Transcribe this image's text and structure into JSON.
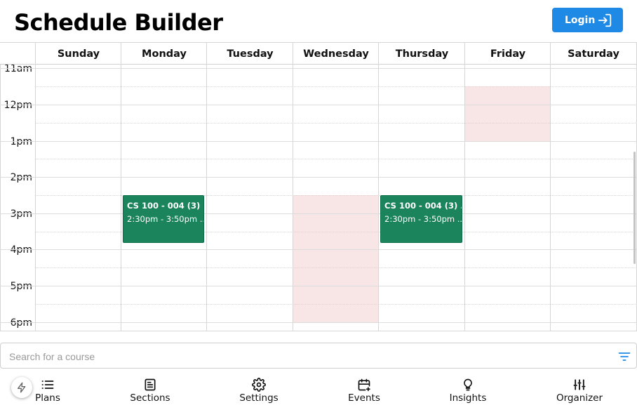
{
  "app": {
    "title": "Schedule Builder"
  },
  "header": {
    "login_label": "Login"
  },
  "colors": {
    "accent": "#1f8ae6",
    "event": "#1b845c",
    "unavailable": "#f8e6e7"
  },
  "calendar": {
    "days": [
      "Sunday",
      "Monday",
      "Tuesday",
      "Wednesday",
      "Thursday",
      "Friday",
      "Saturday"
    ],
    "hours": [
      "11am",
      "12pm",
      "1pm",
      "2pm",
      "3pm",
      "4pm",
      "5pm",
      "6pm"
    ],
    "events": [
      {
        "title": "CS 100 - 004 (3) ...",
        "time": "2:30pm - 3:50pm ...",
        "day": "Monday"
      },
      {
        "title": "CS 100 - 004 (3) ...",
        "time": "2:30pm - 3:50pm ...",
        "day": "Thursday"
      }
    ],
    "unavailable": [
      {
        "day": "Friday",
        "start": "12pm",
        "end": "1pm"
      },
      {
        "day": "Wednesday",
        "start": "2:30pm",
        "end": "6:30pm"
      }
    ]
  },
  "search": {
    "placeholder": "Search for a course",
    "value": ""
  },
  "nav": [
    {
      "label": "Plans",
      "icon": "list-icon"
    },
    {
      "label": "Sections",
      "icon": "document-icon"
    },
    {
      "label": "Settings",
      "icon": "gear-icon"
    },
    {
      "label": "Events",
      "icon": "calendar-add-icon"
    },
    {
      "label": "Insights",
      "icon": "lightbulb-icon"
    },
    {
      "label": "Organizer",
      "icon": "sliders-icon"
    }
  ],
  "fab": {
    "icon": "lightning-icon"
  }
}
